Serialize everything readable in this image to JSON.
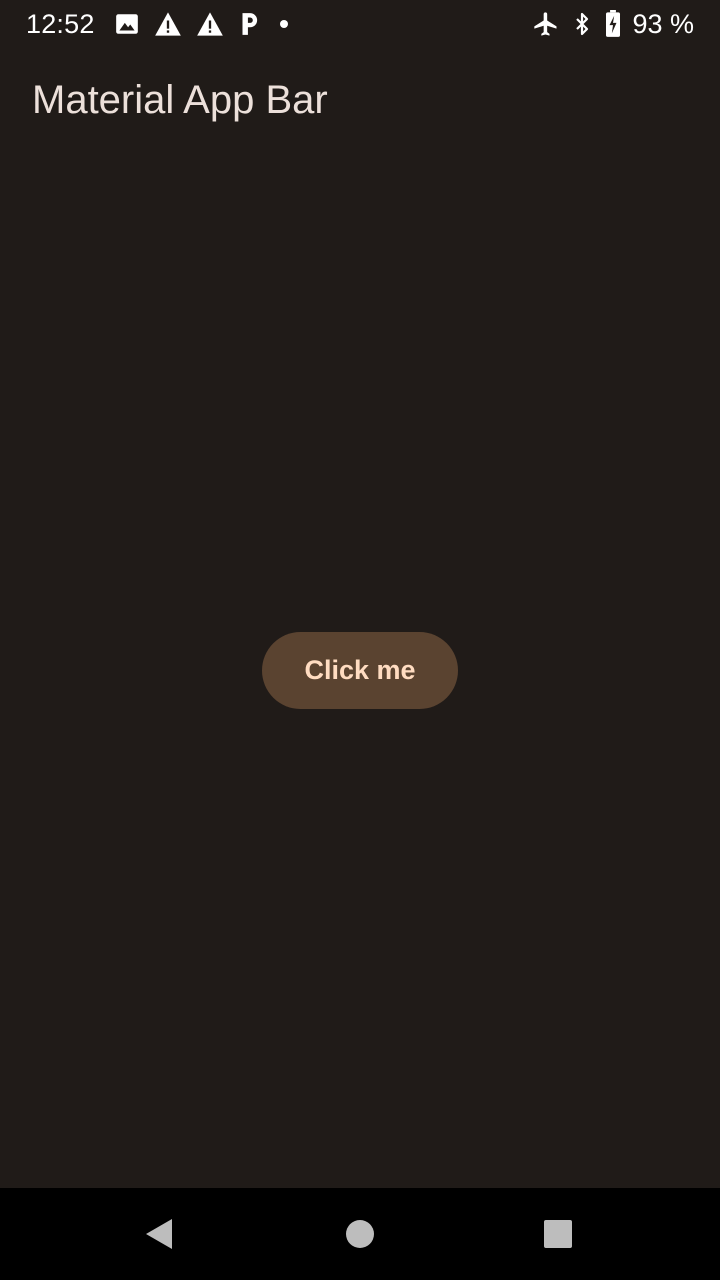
{
  "status_bar": {
    "time": "12:52",
    "battery_percent": "93 %",
    "left_icons": [
      "image-icon",
      "warning-icon",
      "warning-icon",
      "parking-icon",
      "dot-icon"
    ],
    "right_icons": [
      "airplane-icon",
      "bluetooth-icon",
      "battery-charging-icon"
    ]
  },
  "app_bar": {
    "title": "Material App Bar"
  },
  "main": {
    "button_label": "Click me"
  },
  "nav_bar": {
    "buttons": [
      "back-icon",
      "home-icon",
      "recents-icon"
    ]
  },
  "colors": {
    "background": "#201b18",
    "title_text": "#ece0da",
    "button_bg": "#5a4330",
    "button_text": "#ffdcc1",
    "nav_bg": "#000000",
    "nav_icon": "#bdbdbd"
  }
}
